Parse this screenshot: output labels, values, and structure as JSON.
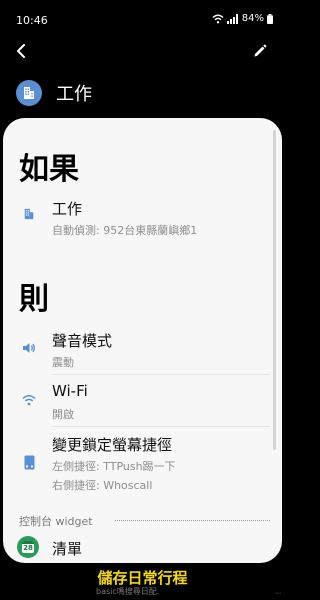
{
  "status_bar": {
    "time": "10:46",
    "battery": "84%"
  },
  "routine": {
    "title": "工作",
    "icon": "building-icon"
  },
  "if_section": {
    "heading": "如果",
    "items": [
      {
        "title": "工作",
        "subtitle": "自動偵測: 952台東縣蘭嶼鄉1",
        "icon": "building-icon"
      }
    ]
  },
  "then_section": {
    "heading": "則",
    "items": [
      {
        "title": "聲音模式",
        "subtitle": "震動",
        "icon": "volume-icon"
      },
      {
        "title": "Wi-Fi",
        "subtitle": "開啟",
        "icon": "wifi-icon"
      },
      {
        "title": "變更鎖定螢幕捷徑",
        "subtitle": "左側捷徑: TTPush踢一下",
        "subtitle2": "右側捷徑: Whoscall",
        "icon": "lock-screen-icon"
      }
    ]
  },
  "widget_section": {
    "label": "控制台 widget",
    "items": [
      {
        "title": "清單",
        "icon": "calendar-icon",
        "badge": "28"
      }
    ]
  },
  "bottom": {
    "save_label": "儲存日常行程",
    "caption": "basic嗎搜尋日配."
  },
  "colors": {
    "accent_yellow": "#f5d90a",
    "icon_blue": "#5b8fd4",
    "calendar_green": "#2a9a5a"
  }
}
